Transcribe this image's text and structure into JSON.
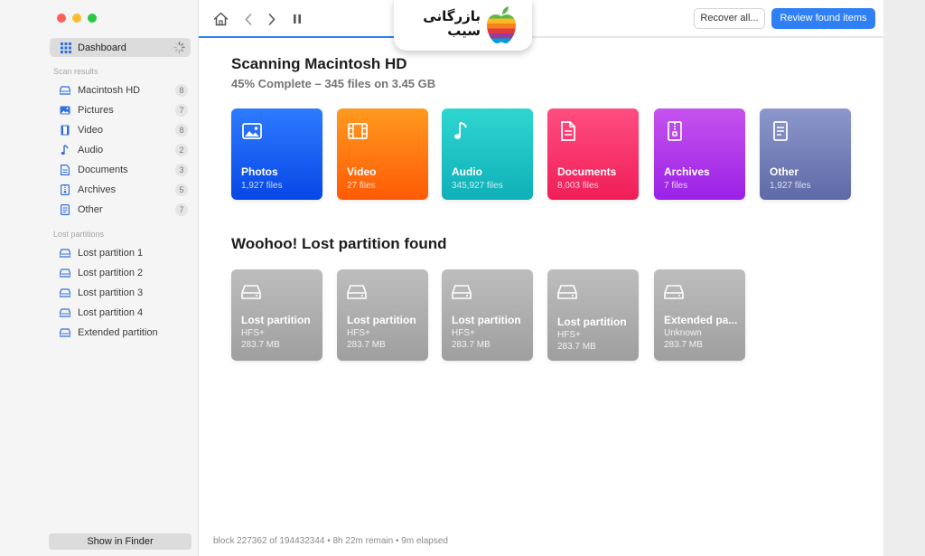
{
  "logo": {
    "line1": "بازرگانی",
    "line2": "سیب"
  },
  "sidebar": {
    "dashboard_label": "Dashboard",
    "scan_results_label": "Scan results",
    "scan_items": [
      {
        "label": "Macintosh HD",
        "count": "8",
        "icon": "drive-icon"
      },
      {
        "label": "Pictures",
        "count": "7",
        "icon": "photo-icon"
      },
      {
        "label": "Video",
        "count": "8",
        "icon": "film-icon"
      },
      {
        "label": "Audio",
        "count": "2",
        "icon": "music-note-icon"
      },
      {
        "label": "Documents",
        "count": "3",
        "icon": "document-icon"
      },
      {
        "label": "Archives",
        "count": "5",
        "icon": "archive-icon"
      },
      {
        "label": "Other",
        "count": "7",
        "icon": "other-file-icon"
      }
    ],
    "lost_partitions_label": "Lost partitions",
    "partition_items": [
      {
        "label": "Lost partition 1"
      },
      {
        "label": "Lost partition 2"
      },
      {
        "label": "Lost partition 3"
      },
      {
        "label": "Lost partition 4"
      },
      {
        "label": "Extended partition"
      }
    ],
    "show_in_finder": "Show in Finder"
  },
  "toolbar": {
    "recover_all": "Recover all...",
    "review_found": "Review found items",
    "progress": 0.45
  },
  "main": {
    "title": "Scanning Macintosh HD",
    "subtitle": "45% Complete – 345 files on 3.45 GB",
    "categories": [
      {
        "name": "Photos",
        "count": "1,927 files",
        "color_top": "#2e7bff",
        "color_bottom": "#0747e6",
        "icon": "photo-icon"
      },
      {
        "name": "Video",
        "count": "27 files",
        "color_top": "#ff9a1f",
        "color_bottom": "#ff5a05",
        "icon": "film-icon"
      },
      {
        "name": "Audio",
        "count": "345,927 files",
        "color_top": "#2ed6d0",
        "color_bottom": "#0fb0b8",
        "icon": "music-note-icon"
      },
      {
        "name": "Documents",
        "count": "8,003 files",
        "color_top": "#ff4d80",
        "color_bottom": "#f01e58",
        "icon": "document-icon"
      },
      {
        "name": "Archives",
        "count": "7 files",
        "color_top": "#c653ee",
        "color_bottom": "#9a21e6",
        "icon": "archive-icon"
      },
      {
        "name": "Other",
        "count": "1,927 files",
        "color_top": "#8c97cc",
        "color_bottom": "#5e6aa6",
        "icon": "other-file-icon"
      }
    ],
    "lost_title": "Woohoo! Lost partition found",
    "partitions": [
      {
        "name": "Lost partition",
        "fs": "HFS+",
        "size": "283.7 MB"
      },
      {
        "name": "Lost partition",
        "fs": "HFS+",
        "size": "283.7 MB"
      },
      {
        "name": "Lost partition",
        "fs": "HFS+",
        "size": "283.7 MB"
      },
      {
        "name": "Lost partition",
        "fs": "HFS+",
        "size": "283.7 MB"
      },
      {
        "name": "Extended pa...",
        "fs": "Unknown",
        "size": "283.7 MB"
      }
    ]
  },
  "status": "block 227362 of 194432344 • 8h 22m remain • 9m elapsed"
}
